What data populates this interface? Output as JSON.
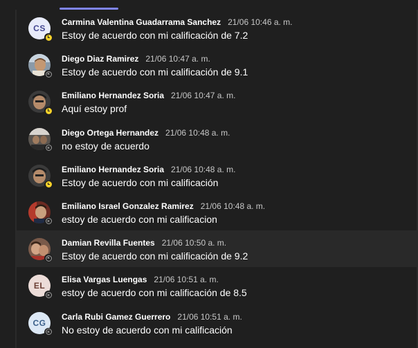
{
  "messages": [
    {
      "author": "Carmina Valentina Guadarrama Sanchez",
      "time": "21/06 10:46 a. m.",
      "text": "Estoy de acuerdo con mi calificación de 7.2",
      "initials": "CS",
      "presence": "away"
    },
    {
      "author": "Diego Diaz Ramirez",
      "time": "21/06 10:47 a. m.",
      "text": "Estoy de acuerdo con mi calificación de 9.1",
      "presence": "offline"
    },
    {
      "author": "Emiliano Hernandez Soria",
      "time": "21/06 10:47 a. m.",
      "text": "Aquí estoy prof",
      "presence": "away"
    },
    {
      "author": "Diego Ortega Hernandez",
      "time": "21/06 10:48 a. m.",
      "text": "no estoy de acuerdo",
      "presence": "offline"
    },
    {
      "author": "Emiliano Hernandez Soria",
      "time": "21/06 10:48 a. m.",
      "text": "Estoy de acuerdo con mi calificación",
      "presence": "away"
    },
    {
      "author": "Emiliano Israel Gonzalez Ramirez",
      "time": "21/06 10:48 a. m.",
      "text": "estoy de acuerdo con mi calificacion",
      "presence": "offline"
    },
    {
      "author": "Damian Revilla Fuentes",
      "time": "21/06 10:50 a. m.",
      "text": "Estoy de acuerdo con mi calificación de 9.2",
      "presence": "offline"
    },
    {
      "author": "Elisa Vargas Luengas",
      "time": "21/06 10:51 a. m.",
      "text": "estoy de acuerdo con mi calificación de 8.5",
      "initials": "EL",
      "presence": "offline"
    },
    {
      "author": "Carla Rubi Gamez Guerrero",
      "time": "21/06 10:51 a. m.",
      "text": "No estoy de acuerdo con mi calificación",
      "initials": "CG",
      "presence": "offline"
    }
  ],
  "colors": {
    "background": "#1f1f1f",
    "accent": "#7f85f5",
    "away": "#f8d22a",
    "offline": "#9e9e9e"
  }
}
